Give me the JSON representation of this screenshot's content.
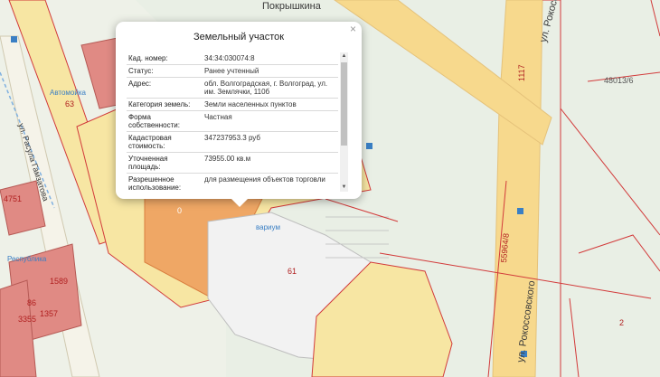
{
  "popup": {
    "title": "Земельный участок",
    "close": "×",
    "rows": [
      {
        "key": "Кад. номер:",
        "value": "34:34:030074:8"
      },
      {
        "key": "Статус:",
        "value": "Ранее учтенный"
      },
      {
        "key": "Адрес:",
        "value": "обл. Волгоградская, г. Волгоград, ул. им. Землячки, 110б"
      },
      {
        "key": "Категория земель:",
        "value": "Земли населенных пунктов"
      },
      {
        "key": "Форма собственности:",
        "value": "Частная"
      },
      {
        "key": "Кадастровая стоимость:",
        "value": "347237953.3 руб"
      },
      {
        "key": "Уточненная площадь:",
        "value": "73955.00 кв.м"
      },
      {
        "key": "Разрешенное использование:",
        "value": "для размещения объектов торговли"
      }
    ]
  },
  "map_labels": {
    "street_pokryshkina": "Покрышкина",
    "street_rokossovskogo_top": "ул. Рокоссо",
    "street_rokossovskogo_bottom": "ул. Рокоссовского",
    "street_gamzatova": "ул. Расула Гамзатова",
    "poi_avtomoika": "Автомойка",
    "poi_respublika": "Республика",
    "poi_akvarium": "вариум",
    "parcel_0": "0",
    "parcel_61": "61",
    "parcel_2": "2",
    "parcel_86": "86",
    "parcel_1117": "1117",
    "parcel_48013": "48013/6",
    "parcel_55964": "55964/8",
    "parcel_63": "63",
    "parcel_4751": "4751",
    "parcel_3355": "3355",
    "parcel_1357": "1357",
    "parcel_1589": "1589"
  },
  "colors": {
    "map_background": "#e9efe5",
    "road_yellow": "#f7d98d",
    "parcel_fill": "#f7e6a3",
    "parcel_border": "#d23a3a",
    "selected_parcel": "#efa765",
    "building_red": "#e08a84",
    "mall_roof": "#f0f0f0"
  }
}
